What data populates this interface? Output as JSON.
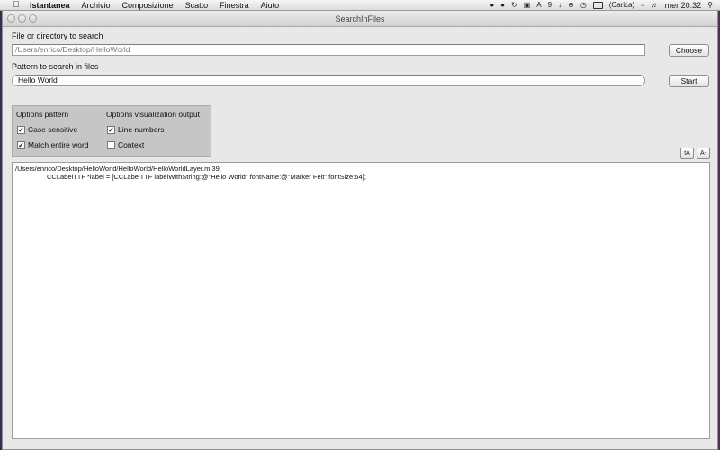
{
  "menubar": {
    "app_name": "Istantanea",
    "menus": [
      "Archivio",
      "Composizione",
      "Scatto",
      "Finestra",
      "Aiuto"
    ],
    "status": {
      "notification_count": "9",
      "battery_label": "(Carica)",
      "clock": "mer 20:32"
    }
  },
  "window": {
    "title": "SearchInFiles"
  },
  "form": {
    "path_label": "File or directory to search",
    "path_value": "/Users/enrico/Desktop/HelloWorld",
    "choose_label": "Choose",
    "pattern_label": "Pattern to search in files",
    "pattern_value": "Hello World",
    "start_label": "Start"
  },
  "options": {
    "pattern_heading": "Options pattern",
    "visualization_heading": "Options visualization output",
    "case_sensitive": {
      "label": "Case sensitive",
      "checked": true
    },
    "match_word": {
      "label": "Match entire word",
      "checked": true
    },
    "line_numbers": {
      "label": "Line numbers",
      "checked": true
    },
    "context": {
      "label": "Context",
      "checked": false
    }
  },
  "font_buttons": {
    "increase": "tA",
    "decrease": "A-"
  },
  "output": {
    "lines": [
      "/Users/enrico/Desktop/HelloWorld/HelloWorld/HelloWorldLayer.m:39:",
      "CCLabelTTF *label = [CCLabelTTF labelWithString:@\"Hello World\" fontName:@\"Marker Felt\" fontSize:64];"
    ]
  }
}
